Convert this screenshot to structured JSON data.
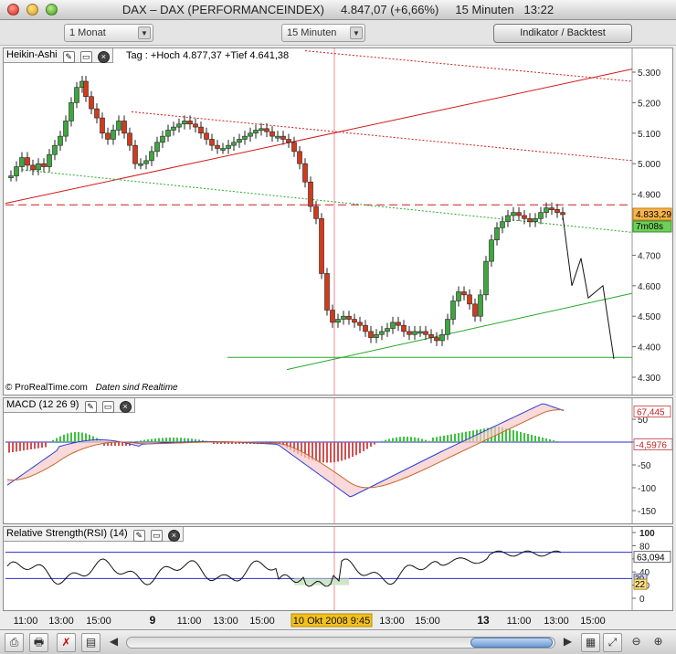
{
  "window": {
    "title": "DAX – DAX (PERFORMANCEINDEX)     4.847,07 (+6,66%)     15 Minuten   13:22"
  },
  "toolbar": {
    "period_select": "1 Monat",
    "interval_select": "15 Minuten",
    "indicator_button": "Indikator / Backtest"
  },
  "price_panel": {
    "label": "Heikin-Ashi",
    "info": "Tag : +Hoch 4.877,37 +Tief 4.641,38",
    "y_ticks": [
      "5.300",
      "5.200",
      "5.100",
      "5.000",
      "4.900",
      "4.800",
      "4.700",
      "4.600",
      "4.500",
      "4.400",
      "4.300"
    ],
    "last_price": "4.833,29",
    "countdown": "7m08s",
    "credit": "© ProRealTime.com",
    "realtime_note": "Daten sind Realtime"
  },
  "macd_panel": {
    "label": "MACD (12 26 9)",
    "y_ticks": [
      "50",
      "0",
      "-50",
      "-100",
      "-150"
    ],
    "value_macd": "67,445",
    "value_hist": "-4,5976"
  },
  "rsi_panel": {
    "label": "Relative Strength(RSI) (14)",
    "y_ticks": [
      "100",
      "80",
      "60",
      "40",
      "20",
      "0"
    ],
    "value_rsi": "63,094",
    "value_low": "22",
    "value_30": "30"
  },
  "time_axis": {
    "labels": [
      "11:00",
      "13:00",
      "15:00",
      "9",
      "11:00",
      "13:00",
      "15:00",
      "10 Okt 2008 9:45",
      "13:00",
      "15:00",
      "13",
      "11:00",
      "13:00",
      "15:00"
    ]
  },
  "colors": {
    "bull": "#3fa63f",
    "bear": "#d23a1a",
    "trend_red": "#d11a1a",
    "trend_green": "#27a727",
    "cursor": "#f08a9a"
  },
  "icons": {
    "wrench": "wrench-icon",
    "window": "window-icon",
    "close": "close-icon"
  }
}
